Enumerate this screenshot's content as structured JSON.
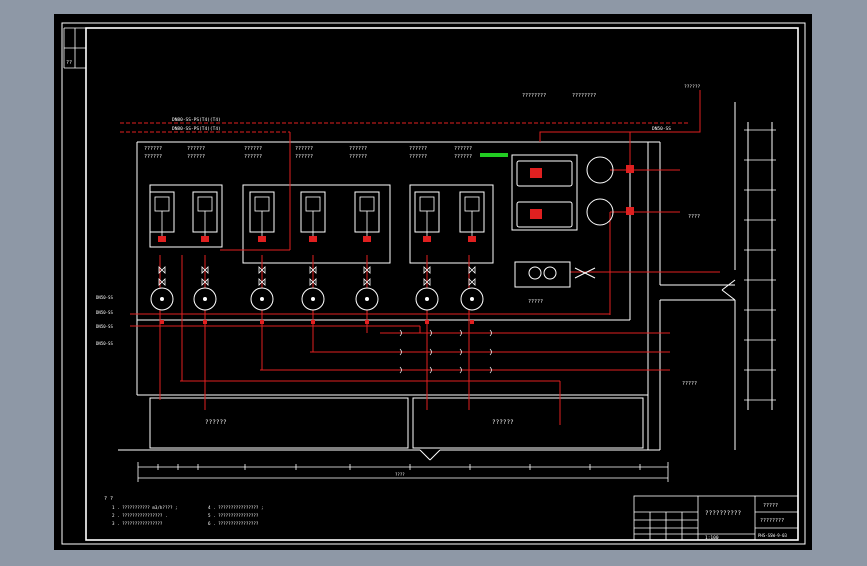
{
  "colors": {
    "background": "#8e98a6",
    "canvas": "#000000",
    "line_white": "#ffffff",
    "line_red": "#e02020",
    "accent_green": "#22cc22"
  },
  "drawing": {
    "left_tag": "??",
    "top_inlet_1": "DN80-SS-PS(T4)(T4)",
    "top_inlet_2": "DN80-SS-PS(T4)(T4)",
    "top_right_label_1": "????????",
    "top_right_label_2": "????????",
    "top_right_label_3": "??????",
    "right_pipe_label": "DN50-SS",
    "tank_labels_top": [
      "??????",
      "??????",
      "??????",
      "??????",
      "??????",
      "??????",
      "??????"
    ],
    "tank_labels_bottom": [
      "??????",
      "??????",
      "??????",
      "??????",
      "??????",
      "??????",
      "??????"
    ],
    "left_side_labels": [
      "DN50-SS",
      "DN50-SS",
      "DN50-SS",
      "DN50-SS"
    ],
    "pump_skid_label": "?????",
    "right_room_label_1": "????",
    "right_room_label_2": "?????",
    "pit_label_1": "??????",
    "pit_label_2": "??????",
    "dim_total": "????"
  },
  "notes": {
    "heading": "? ?",
    "items": [
      "1 . ??????????? m3/h???? ;",
      "2 . ???????????????? .",
      "3 . ????????????????",
      "4 . ???????????????? ;",
      "5 . ????????????????",
      "6 . ????????????????"
    ]
  },
  "title_block": {
    "drawing_title": "??????????",
    "company": "?????",
    "sheet_name": "????????",
    "drawing_no": "PHS-SSW-9-03",
    "scale_label": "1:100"
  }
}
